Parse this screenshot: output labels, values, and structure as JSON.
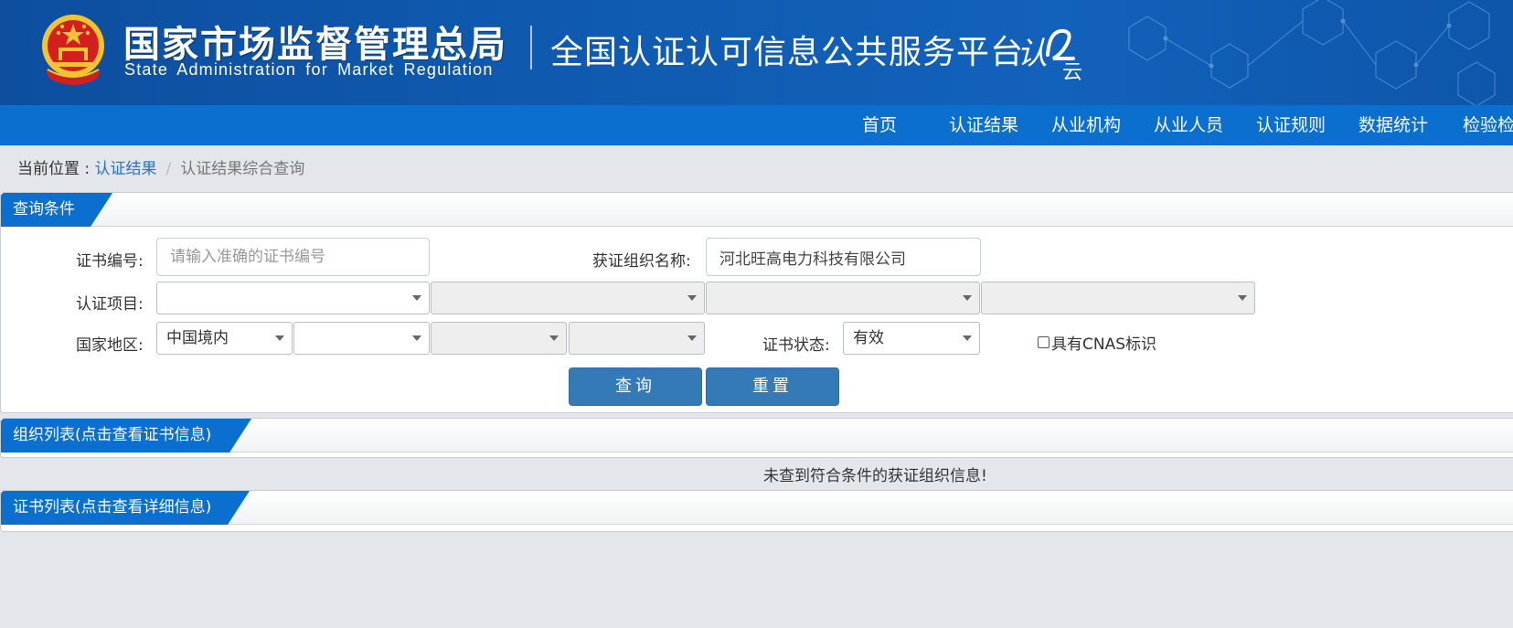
{
  "header": {
    "agency_cn": "国家市场监督管理总局",
    "agency_en": "State Administration  for  Market Regulation",
    "platform_title": "全国认证认可信息公共服务平台",
    "logo_text_1": "认",
    "logo_text_2": "云"
  },
  "nav": {
    "items": [
      "首页",
      "认证结果",
      "从业机构",
      "从业人员",
      "认证规则",
      "数据统计",
      "检验检"
    ]
  },
  "breadcrumb": {
    "prefix": "当前位置 : ",
    "link": "认证结果",
    "separator": "/",
    "current": "认证结果综合查询"
  },
  "query_panel": {
    "title": "查询条件",
    "cert_no_label": "证书编号:",
    "cert_no_placeholder": "请输入准确的证书编号",
    "cert_no_value": "",
    "org_name_label": "获证组织名称:",
    "org_name_value": "河北旺高电力科技有限公司",
    "cert_project_label": "认证项目:",
    "cert_project_selects": [
      "",
      "",
      "",
      ""
    ],
    "region_label": "国家地区:",
    "region_selects": [
      "中国境内",
      "",
      "",
      ""
    ],
    "cert_status_label": "证书状态:",
    "cert_status_value": "有效",
    "cnas_label": "具有CNAS标识",
    "cnas_checked": false,
    "search_button": "查询",
    "reset_button": "重置"
  },
  "org_panel": {
    "title": "组织列表(点击查看证书信息)",
    "empty_message": "未查到符合条件的获证组织信息!"
  },
  "cert_panel": {
    "title": "证书列表(点击查看详细信息)"
  },
  "colors": {
    "banner": "#0f5bb1",
    "nav": "#0a6fcf",
    "button": "#337ab7",
    "link": "#2a72c4",
    "background": "#e3e7ec"
  }
}
